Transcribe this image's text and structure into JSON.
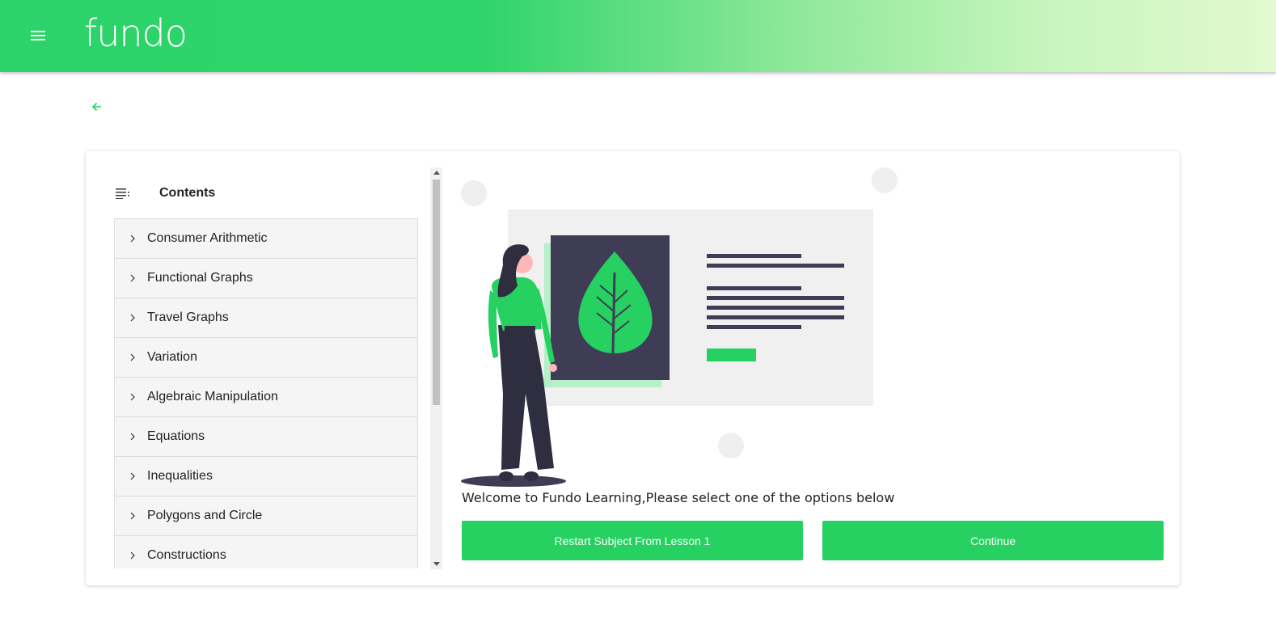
{
  "header": {
    "logo_text": "fundo",
    "menu_icon": "hamburger-menu-icon"
  },
  "back": {
    "icon": "arrow-left-icon"
  },
  "sidebar": {
    "title": "Contents",
    "icon": "list-icon",
    "items": [
      {
        "label": "Consumer Arithmetic"
      },
      {
        "label": "Functional Graphs"
      },
      {
        "label": "Travel Graphs"
      },
      {
        "label": "Variation"
      },
      {
        "label": "Algebraic Manipulation"
      },
      {
        "label": "Equations"
      },
      {
        "label": "Inequalities"
      },
      {
        "label": "Polygons and Circle"
      },
      {
        "label": "Constructions"
      }
    ]
  },
  "main": {
    "welcome_text": "Welcome to Fundo Learning,Please select one of the options below",
    "restart_label": "Restart Subject From Lesson 1",
    "continue_label": "Continue"
  },
  "colors": {
    "brand_green": "#26d061",
    "dark_slate": "#3f3d56",
    "light_gray": "#f0f0f0"
  }
}
